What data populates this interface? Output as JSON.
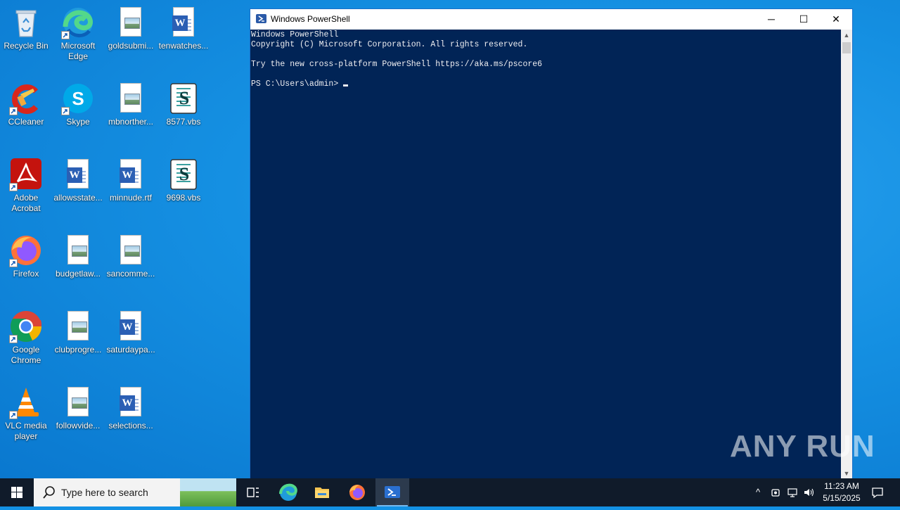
{
  "desktop": {
    "icons": [
      {
        "name": "recycle-bin",
        "label": "Recycle Bin"
      },
      {
        "name": "microsoft-edge",
        "label": "Microsoft Edge"
      },
      {
        "name": "goldsubmi",
        "label": "goldsubmi..."
      },
      {
        "name": "tenwatches",
        "label": "tenwatches..."
      },
      {
        "name": "ccleaner",
        "label": "CCleaner"
      },
      {
        "name": "skype",
        "label": "Skype"
      },
      {
        "name": "mbnorther",
        "label": "mbnorther..."
      },
      {
        "name": "8577-vbs",
        "label": "8577.vbs"
      },
      {
        "name": "adobe-acrobat",
        "label": "Adobe Acrobat"
      },
      {
        "name": "allowsstate",
        "label": "allowsstate..."
      },
      {
        "name": "minnude-rtf",
        "label": "minnude.rtf"
      },
      {
        "name": "9698-vbs",
        "label": "9698.vbs"
      },
      {
        "name": "firefox",
        "label": "Firefox"
      },
      {
        "name": "budgetlaw",
        "label": "budgetlaw..."
      },
      {
        "name": "sancomme",
        "label": "sancomme..."
      },
      {
        "name": "google-chrome",
        "label": "Google Chrome"
      },
      {
        "name": "clubprogre",
        "label": "clubprogre..."
      },
      {
        "name": "saturdaypa",
        "label": "saturdaypa..."
      },
      {
        "name": "vlc-media-player",
        "label": "VLC media player"
      },
      {
        "name": "followvide",
        "label": "followvide..."
      },
      {
        "name": "selections",
        "label": "selections..."
      }
    ]
  },
  "powershell": {
    "title": "Windows PowerShell",
    "lines": [
      "Windows PowerShell",
      "Copyright (C) Microsoft Corporation. All rights reserved.",
      "",
      "Try the new cross-platform PowerShell https://aka.ms/pscore6",
      ""
    ],
    "prompt": "PS C:\\Users\\admin> ",
    "minimize": "─",
    "maximize": "☐",
    "close": "✕"
  },
  "watermark": "ANY RUN",
  "taskbar": {
    "search_placeholder": "Type here to search",
    "time": "11:23 AM",
    "date": "5/15/2025"
  }
}
